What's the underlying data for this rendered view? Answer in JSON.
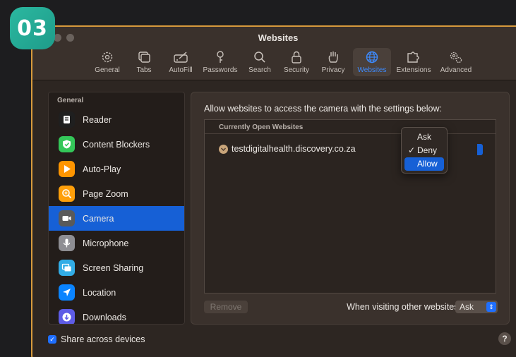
{
  "step": "03",
  "window": {
    "title": "Websites"
  },
  "toolbar": {
    "items": [
      {
        "label": "General",
        "icon": "gear-icon"
      },
      {
        "label": "Tabs",
        "icon": "tabs-icon"
      },
      {
        "label": "AutoFill",
        "icon": "autofill-icon"
      },
      {
        "label": "Passwords",
        "icon": "key-icon"
      },
      {
        "label": "Search",
        "icon": "search-icon"
      },
      {
        "label": "Security",
        "icon": "lock-icon"
      },
      {
        "label": "Privacy",
        "icon": "hand-icon"
      },
      {
        "label": "Websites",
        "icon": "globe-icon",
        "active": true
      },
      {
        "label": "Extensions",
        "icon": "puzzle-icon"
      },
      {
        "label": "Advanced",
        "icon": "gears-icon"
      }
    ]
  },
  "sidebar": {
    "header": "General",
    "items": [
      {
        "label": "Reader",
        "icon": "reader-icon",
        "color": "#1f1f1f"
      },
      {
        "label": "Content Blockers",
        "icon": "shield-check-icon",
        "color": "#34c759"
      },
      {
        "label": "Auto-Play",
        "icon": "play-icon",
        "color": "#ff9500"
      },
      {
        "label": "Page Zoom",
        "icon": "zoom-icon",
        "color": "#ff9f0a"
      },
      {
        "label": "Camera",
        "icon": "camera-icon",
        "color": "#5a5a5a",
        "selected": true
      },
      {
        "label": "Microphone",
        "icon": "microphone-icon",
        "color": "#8e8e93"
      },
      {
        "label": "Screen Sharing",
        "icon": "screen-sharing-icon",
        "color": "#32ade6"
      },
      {
        "label": "Location",
        "icon": "location-arrow-icon",
        "color": "#0a84ff"
      },
      {
        "label": "Downloads",
        "icon": "download-icon",
        "color": "#5e5ce6"
      }
    ]
  },
  "content": {
    "heading": "Allow websites to access the camera with the settings below:",
    "table_header": "Currently Open Websites",
    "site": "testdigitalhealth.discovery.co.za",
    "remove_label": "Remove",
    "other_label": "When visiting other websites:",
    "other_value": "Ask"
  },
  "menu": {
    "options": [
      {
        "label": "Ask",
        "checked": false,
        "highlighted": false
      },
      {
        "label": "Deny",
        "checked": true,
        "highlighted": false
      },
      {
        "label": "Allow",
        "checked": false,
        "highlighted": true
      }
    ],
    "check_glyph": "✓"
  },
  "footer": {
    "share_label": "Share across devices",
    "share_checked": true,
    "help_label": "?"
  },
  "colors": {
    "accent": "#1660d6",
    "badge": "#2bb8a0",
    "window_border": "#d79a3c"
  }
}
